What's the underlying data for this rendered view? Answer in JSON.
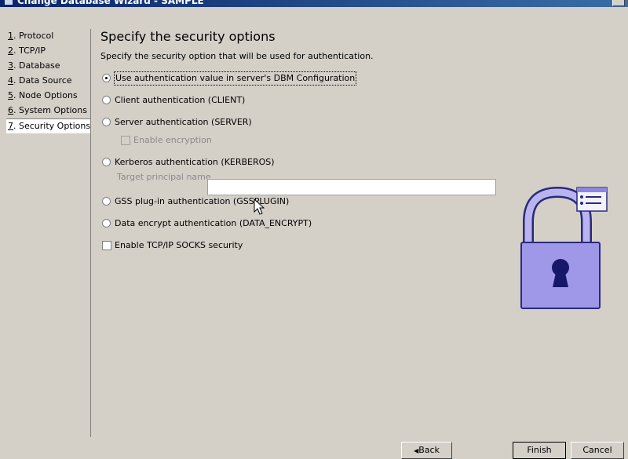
{
  "window": {
    "title": "Change Database Wizard - SAMPLE"
  },
  "nav": {
    "items": [
      {
        "num": "1",
        "label": ". Protocol"
      },
      {
        "num": "2",
        "label": ". TCP/IP"
      },
      {
        "num": "3",
        "label": ". Database"
      },
      {
        "num": "4",
        "label": ". Data Source"
      },
      {
        "num": "5",
        "label": ". Node Options"
      },
      {
        "num": "6",
        "label": ". System Options"
      },
      {
        "num": "7",
        "label": ". Security Options"
      }
    ],
    "selected_index": 6
  },
  "page": {
    "heading": "Specify the security options",
    "description": "Specify the security option that will be used for authentication."
  },
  "options": {
    "dbm": "Use authentication value in server's DBM Configuration",
    "client": "Client authentication (CLIENT)",
    "server": "Server authentication (SERVER)",
    "enable_encryption": "Enable encryption",
    "kerberos": "Kerberos authentication (KERBEROS)",
    "target_principal": "Target principal name",
    "gss": "GSS plug-in authentication (GSSPLUGIN)",
    "data_encrypt": "Data encrypt authentication (DATA_ENCRYPT)",
    "socks": "Enable TCP/IP SOCKS security",
    "selected": "dbm"
  },
  "buttons": {
    "back": "Back",
    "finish": "Finish",
    "cancel": "Cancel"
  },
  "icons": {
    "lock": "padlock-icon",
    "window": "window-icon",
    "back": "arrow-left-icon"
  }
}
